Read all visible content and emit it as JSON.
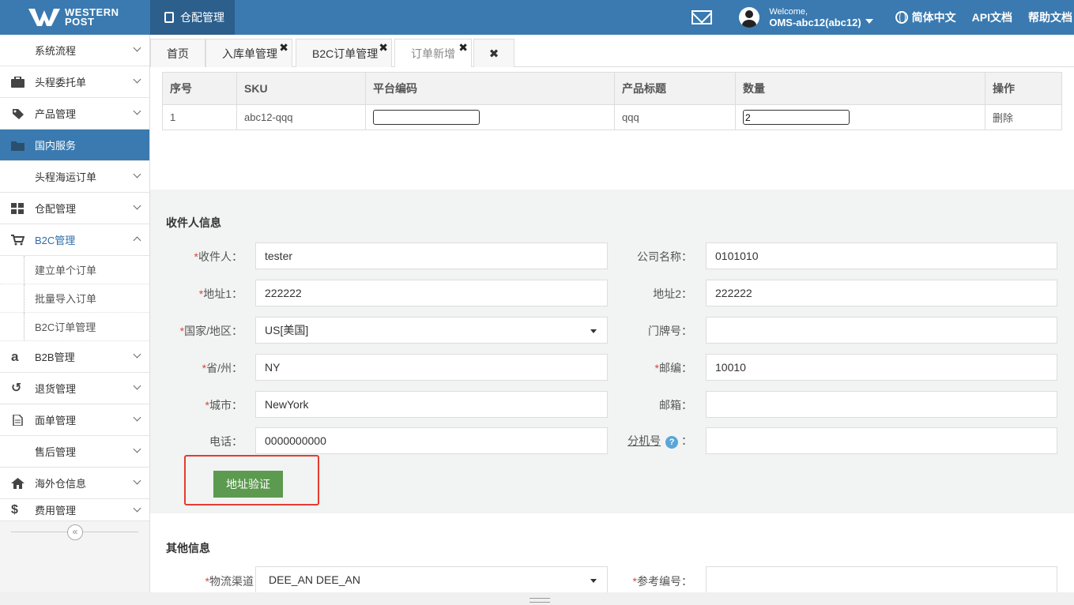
{
  "brand": {
    "line1": "WESTERN",
    "line2": "POST"
  },
  "module": {
    "label": "仓配管理"
  },
  "header": {
    "welcome": "Welcome,",
    "username": "OMS-abc12(abc12)",
    "language": "简体中文",
    "api_docs": "API文档",
    "help_docs": "帮助文档"
  },
  "sidebar": {
    "items": [
      {
        "label": "系统流程",
        "icon": ""
      },
      {
        "label": "头程委托单",
        "icon": "briefcase-icon"
      },
      {
        "label": "产品管理",
        "icon": "tag-icon"
      },
      {
        "label": "国内服务",
        "icon": "folder-icon"
      },
      {
        "label": "头程海运订单",
        "icon": ""
      },
      {
        "label": "仓配管理",
        "icon": "grid-icon"
      },
      {
        "label": "B2C管理",
        "icon": "cart-icon"
      },
      {
        "label": "B2B管理",
        "icon": "amazon-icon"
      },
      {
        "label": "退货管理",
        "icon": "undo-icon"
      },
      {
        "label": "面单管理",
        "icon": "document-icon"
      },
      {
        "label": "售后管理",
        "icon": ""
      },
      {
        "label": "海外仓信息",
        "icon": "home-icon"
      },
      {
        "label": "费用管理",
        "icon": "dollar-icon"
      }
    ],
    "b2c_sub": [
      "建立单个订单",
      "批量导入订单",
      "B2C订单管理"
    ]
  },
  "tabs": [
    "首页",
    "入库单管理",
    "B2C订单管理",
    "订单新增"
  ],
  "items_table": {
    "headers": [
      "序号",
      "SKU",
      "平台编码",
      "产品标题",
      "数量",
      "操作"
    ],
    "rows": [
      {
        "index": "1",
        "sku": "abc12-qqq",
        "platform_code": "",
        "title": "qqq",
        "quantity": "2",
        "action": "删除"
      }
    ]
  },
  "recipient": {
    "section_title": "收件人信息",
    "labels": {
      "name": "收件人",
      "company": "公司名称",
      "address1": "地址1",
      "address2": "地址2",
      "country": "国家/地区",
      "house_no": "门牌号",
      "state": "省/州",
      "zip": "邮编",
      "city": "城市",
      "email": "邮箱",
      "phone": "电话",
      "extension": "分机号"
    },
    "values": {
      "name": "tester",
      "company": "0101010",
      "address1": "222222",
      "address2": "222222",
      "country": "US[美国]",
      "house_no": "",
      "state": "NY",
      "zip": "10010",
      "city": "NewYork",
      "email": "",
      "phone": "0000000000",
      "extension": ""
    },
    "verify_button": "地址验证",
    "help_glyph": "?"
  },
  "other": {
    "section_title": "其他信息",
    "labels": {
      "channel": "物流渠道",
      "reference": "参考编号"
    },
    "values": {
      "channel": "DEE_AN DEE_AN",
      "reference": ""
    }
  },
  "colors": {
    "primary": "#3a7ab0",
    "verify_button": "#5c9a4f",
    "highlight": "#e63b32",
    "required": "#d9463c"
  }
}
